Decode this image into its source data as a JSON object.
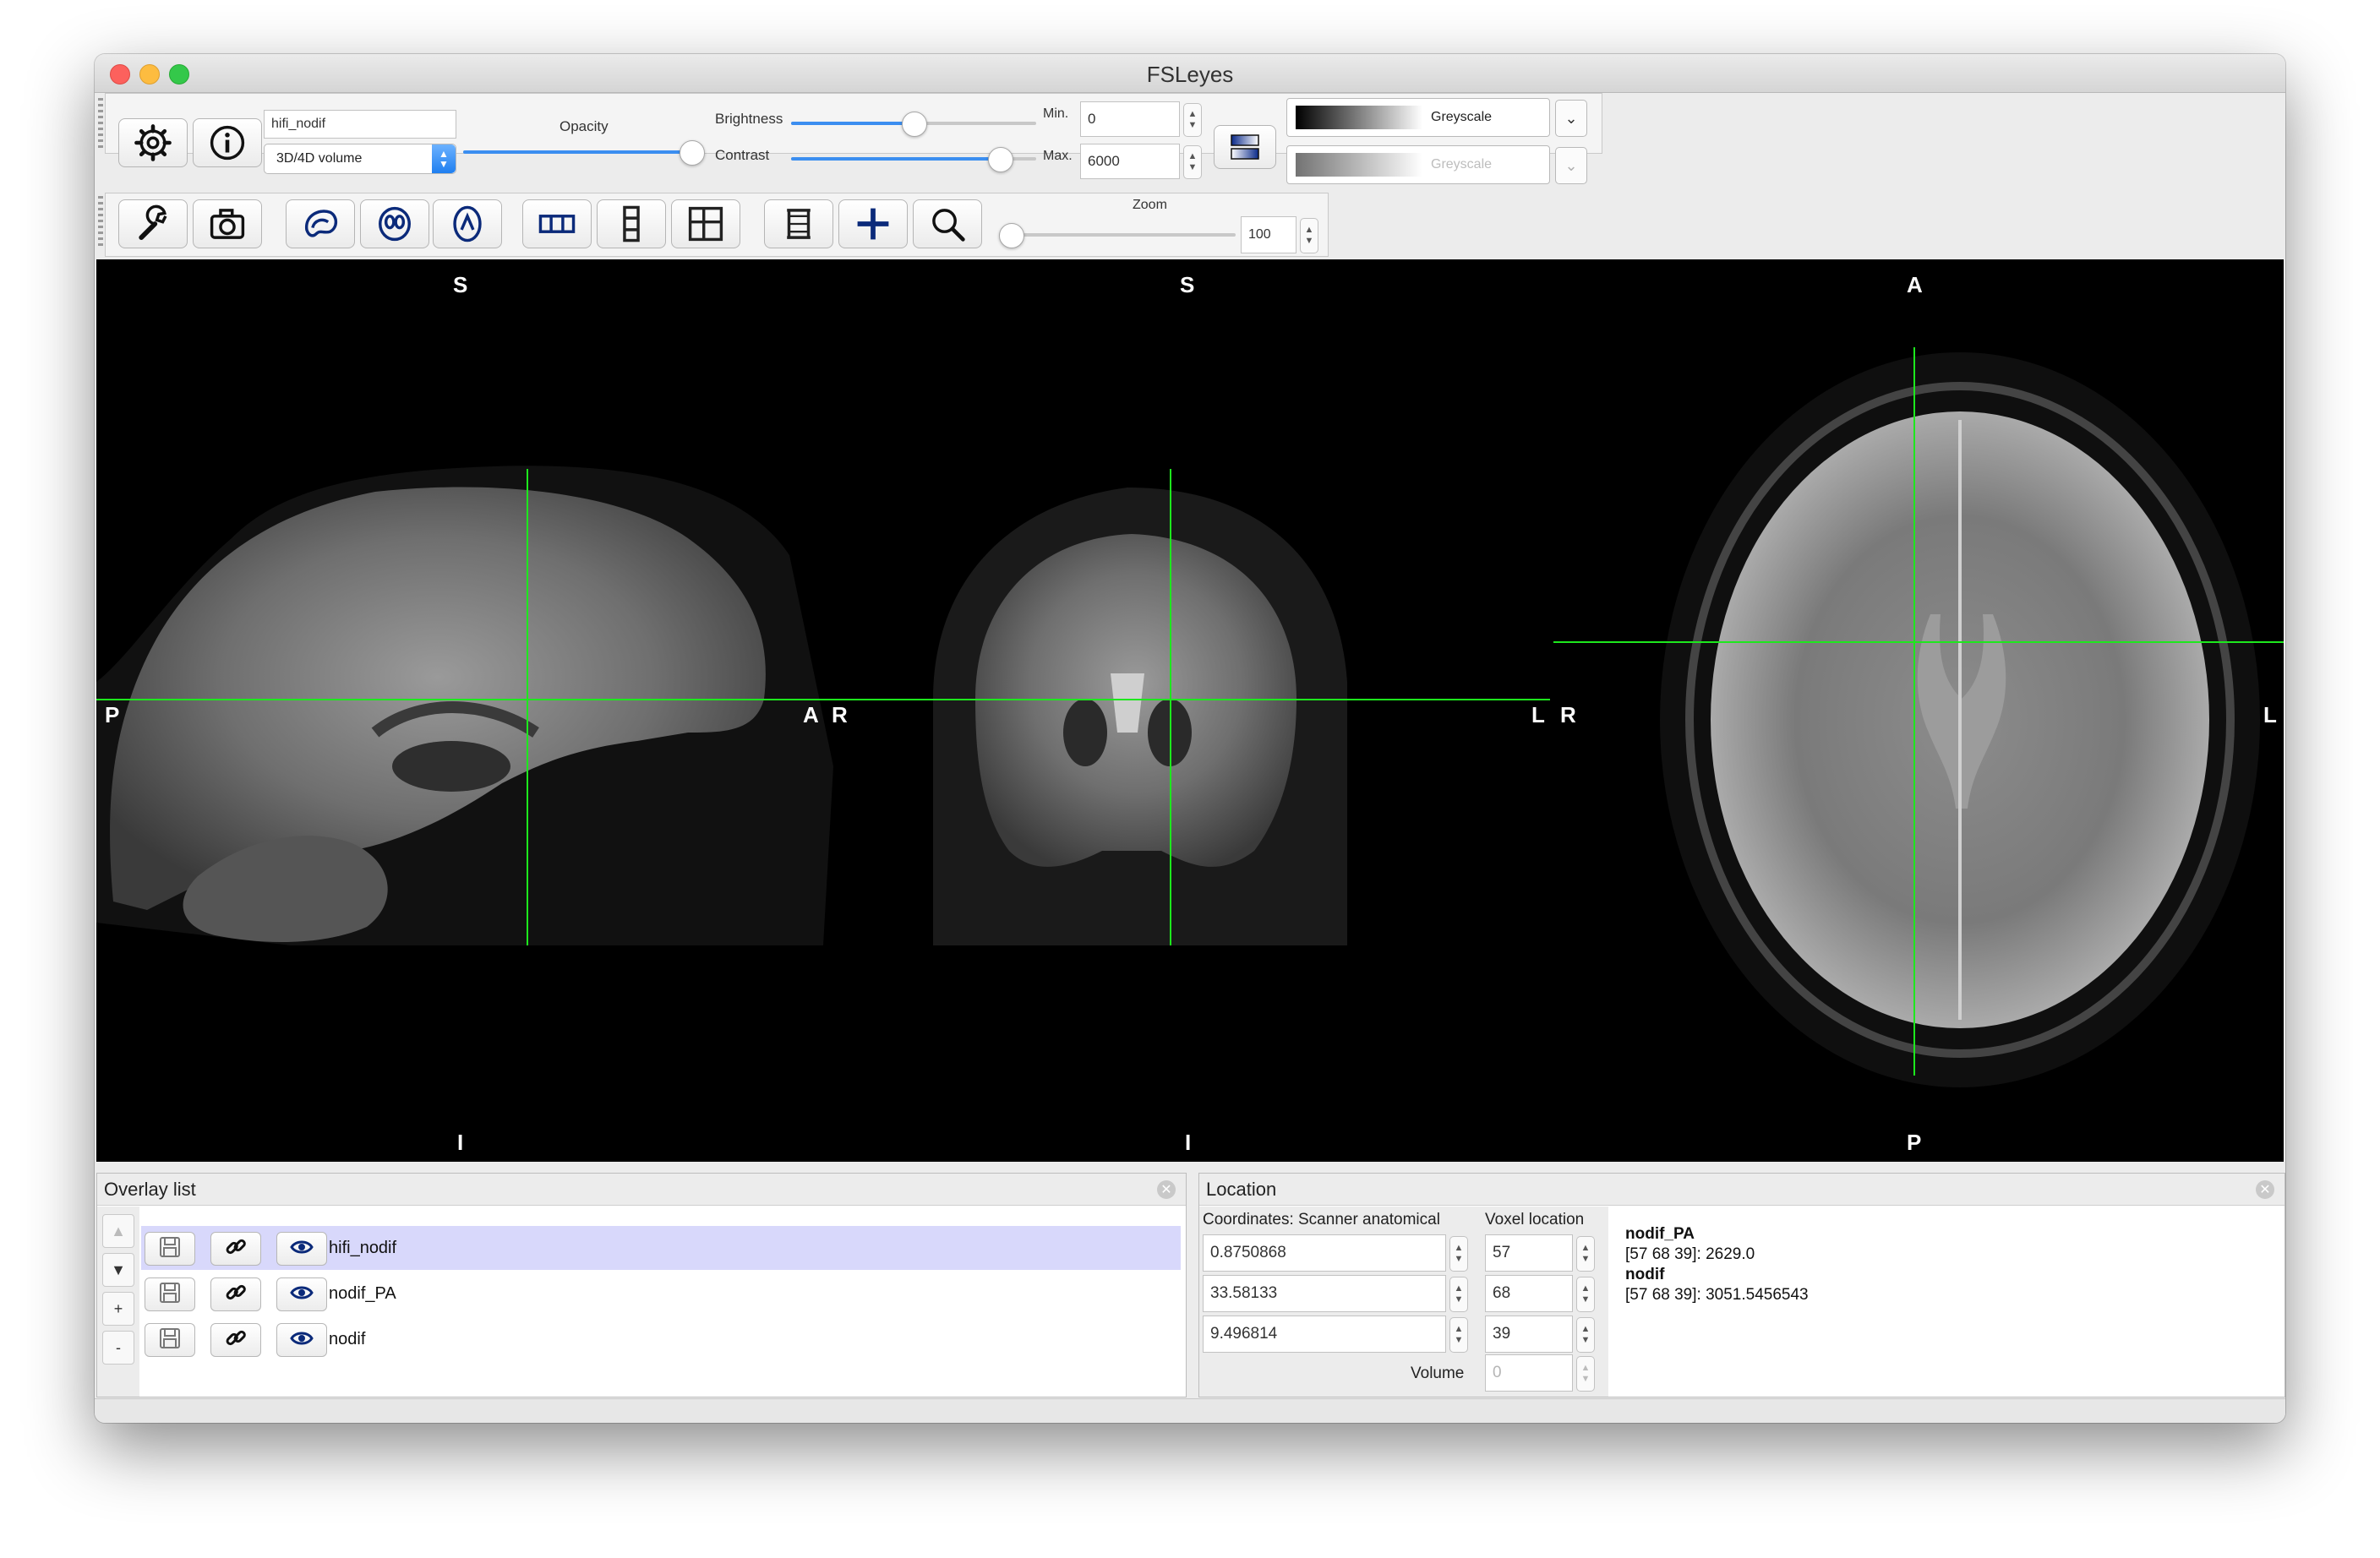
{
  "window": {
    "title": "FSLeyes"
  },
  "overlay_toolbar": {
    "settings_icon": "gear-icon",
    "info_icon": "info-icon",
    "overlay_name": "hifi_nodif",
    "overlay_type": "3D/4D volume",
    "opacity_label": "Opacity",
    "opacity_value": 1.0,
    "brightness_label": "Brightness",
    "brightness_value": 0.5,
    "contrast_label": "Contrast",
    "contrast_value": 0.85,
    "min_label": "Min.",
    "min_value": "0",
    "max_label": "Max.",
    "max_value": "6000",
    "colormap_primary": "Greyscale",
    "colormap_secondary": "Greyscale"
  },
  "ortho_toolbar": {
    "tools": [
      "wrench-icon",
      "camera-icon",
      "sagittal-view-icon",
      "coronal-view-icon",
      "axial-view-icon",
      "horizontal-layout-icon",
      "vertical-layout-icon",
      "grid-layout-icon",
      "movie-mode-icon",
      "cursor-toggle-icon",
      "zoom-icon"
    ],
    "zoom_label": "Zoom",
    "zoom_value": "100",
    "zoom_slider": 0.0
  },
  "views": {
    "sagittal": {
      "top": "S",
      "bottom": "I",
      "left": "P",
      "right": "A"
    },
    "coronal": {
      "top": "S",
      "bottom": "I",
      "left": "R",
      "right": "L"
    },
    "axial": {
      "top": "A",
      "bottom": "P",
      "left": "R",
      "right": "L"
    }
  },
  "overlay_list": {
    "title": "Overlay list",
    "buttons": {
      "up": "▲",
      "down": "▼",
      "add": "+",
      "remove": "-"
    },
    "items": [
      {
        "name": "hifi_nodif",
        "selected": true
      },
      {
        "name": "nodif_PA",
        "selected": false
      },
      {
        "name": "nodif",
        "selected": false
      }
    ]
  },
  "location": {
    "title": "Location",
    "coords_label": "Coordinates: Scanner anatomical",
    "voxel_label": "Voxel location",
    "coords": [
      "0.8750868",
      "33.58133",
      "9.496814"
    ],
    "voxels": [
      "57",
      "68",
      "39"
    ],
    "volume_label": "Volume",
    "volume_value": "0",
    "info": [
      {
        "name": "nodif_PA",
        "value": "[57 68 39]: 2629.0"
      },
      {
        "name": "nodif",
        "value": "[57 68 39]: 3051.5456543"
      }
    ]
  },
  "colors": {
    "accent": "#3b8ef0",
    "crosshair": "#1de81d",
    "selection": "#d8d8fb"
  }
}
